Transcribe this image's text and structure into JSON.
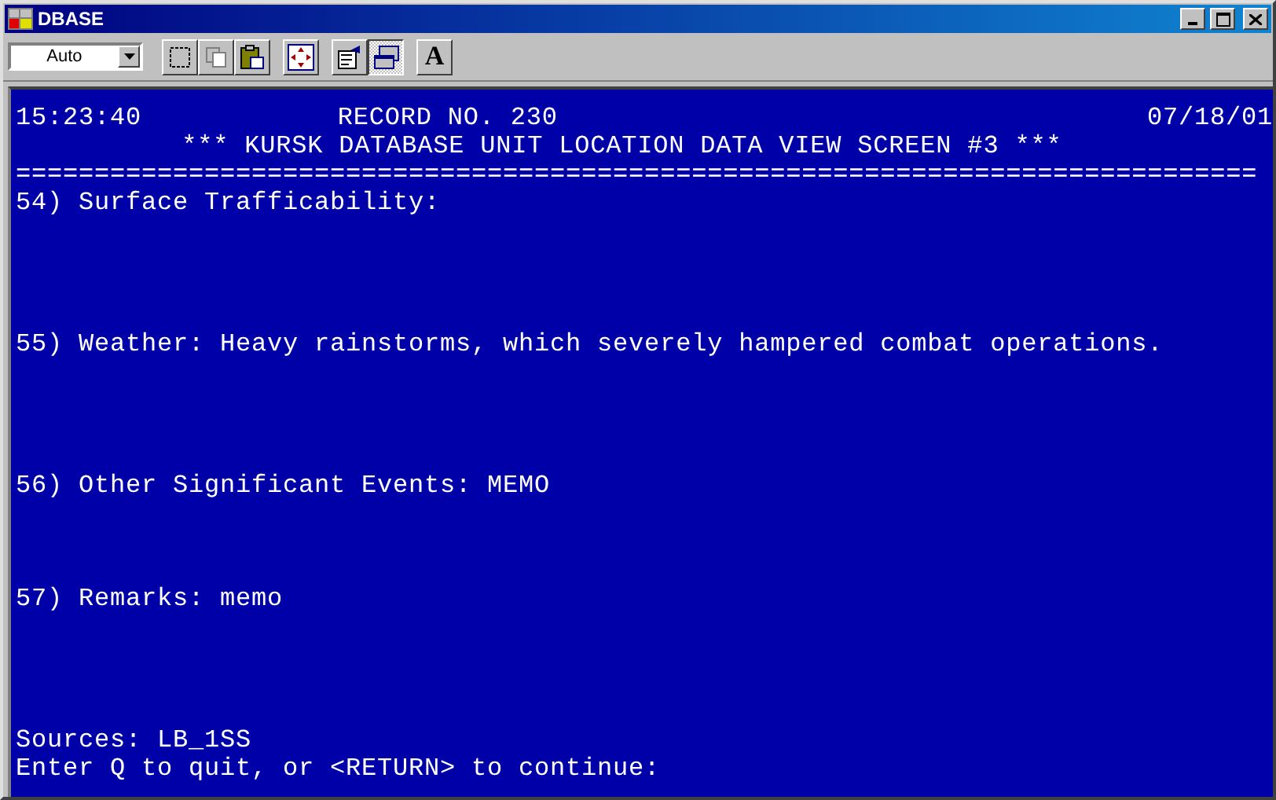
{
  "window": {
    "title": "DBASE"
  },
  "toolbar": {
    "font_size": "Auto",
    "buttons": [
      {
        "kind": "mark",
        "pressed": false
      },
      {
        "kind": "copy",
        "pressed": false
      },
      {
        "kind": "paste",
        "pressed": false
      },
      {
        "kind": "fullscreen",
        "pressed": false
      },
      {
        "kind": "properties",
        "pressed": false
      },
      {
        "kind": "background",
        "pressed": true
      },
      {
        "kind": "font",
        "pressed": false,
        "label": "A"
      }
    ]
  },
  "console": {
    "time": "15:23:40",
    "record": "RECORD NO. 230",
    "date": "07/18/01",
    "heading": "*** KURSK DATABASE UNIT LOCATION DATA VIEW SCREEN #3 ***",
    "rule": "===============================================================================",
    "fields": [
      {
        "text": "54) Surface Trafficability:"
      },
      {
        "text": "55) Weather: Heavy rainstorms, which severely hampered combat operations."
      },
      {
        "text": "56) Other Significant Events: MEMO"
      },
      {
        "text": "57) Remarks: memo"
      }
    ],
    "sources": "Sources: LB_1SS",
    "prompt": "Enter Q to quit, or <RETURN> to continue:"
  }
}
